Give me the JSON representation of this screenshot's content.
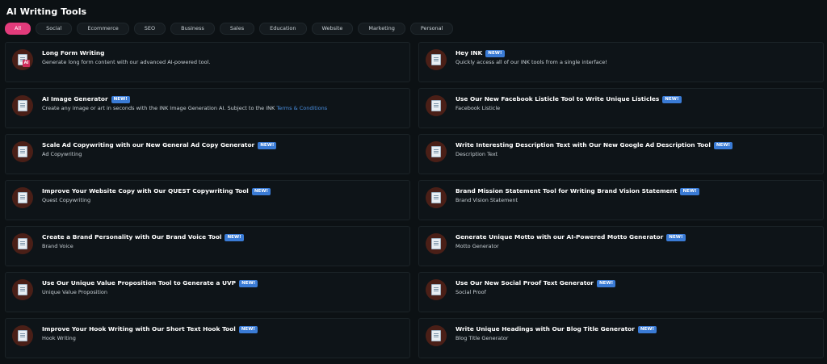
{
  "page": {
    "title": "AI Writing Tools"
  },
  "filters": [
    "All",
    "Social",
    "Ecommerce",
    "SEO",
    "Business",
    "Sales",
    "Education",
    "Website",
    "Marketing",
    "Personal"
  ],
  "new_badge": "NEW!",
  "cards": [
    {
      "title": "Long Form Writing",
      "desc": "Generate long form content with our advanced AI-powered tool.",
      "icon": "long-form-ai-icon",
      "icon_text": "AI"
    },
    {
      "title": "Hey INK",
      "desc": "Quickly access all of our INK tools from a single interface!",
      "icon": "document-icon"
    },
    {
      "title": "AI Image Generator",
      "desc": "Create any image or art in seconds with the INK Image Generation AI. Subject to the INK ",
      "link": "Terms & Conditions",
      "icon": "document-icon"
    },
    {
      "title": "Use Our New Facebook Listicle Tool to Write Unique Listicles",
      "desc": "Facebook Listicle",
      "icon": "document-icon"
    },
    {
      "title": "Scale Ad Copywriting with our New General Ad Copy Generator",
      "desc": "Ad Copywriting",
      "icon": "document-icon"
    },
    {
      "title": "Write Interesting Description Text with Our New Google Ad Description Tool",
      "desc": "Description Text",
      "icon": "document-icon"
    },
    {
      "title": "Improve Your Website Copy with Our QUEST Copywriting Tool",
      "desc": "Quest Copywriting",
      "icon": "document-icon"
    },
    {
      "title": "Brand Mission Statement Tool for Writing Brand Vision Statement",
      "desc": "Brand Vision Statement",
      "icon": "document-icon"
    },
    {
      "title": "Create a Brand Personality with Our Brand Voice Tool",
      "desc": "Brand Voice",
      "icon": "document-icon"
    },
    {
      "title": "Generate Unique Motto with our AI-Powered Motto Generator",
      "desc": "Motto Generator",
      "icon": "document-icon"
    },
    {
      "title": "Use Our Unique Value Proposition Tool to Generate a UVP",
      "desc": "Unique Value Proposition",
      "icon": "document-icon"
    },
    {
      "title": "Use Our New Social Proof Text Generator",
      "desc": "Social Proof",
      "icon": "document-icon"
    },
    {
      "title": "Improve Your Hook Writing with Our Short Text Hook Tool",
      "desc": "Hook Writing",
      "icon": "document-icon"
    },
    {
      "title": "Write Unique Headings with Our Blog Title Generator",
      "desc": "Blog Title Generator",
      "icon": "document-icon"
    }
  ],
  "new_flags": [
    false,
    true,
    true,
    true,
    true,
    true,
    true,
    true,
    true,
    true,
    true,
    true,
    true,
    true
  ],
  "colors": {
    "accent": "#e23b7b",
    "badge": "#3a7bd5",
    "background": "#0c1114",
    "icon_bg": "#4a1f17"
  }
}
